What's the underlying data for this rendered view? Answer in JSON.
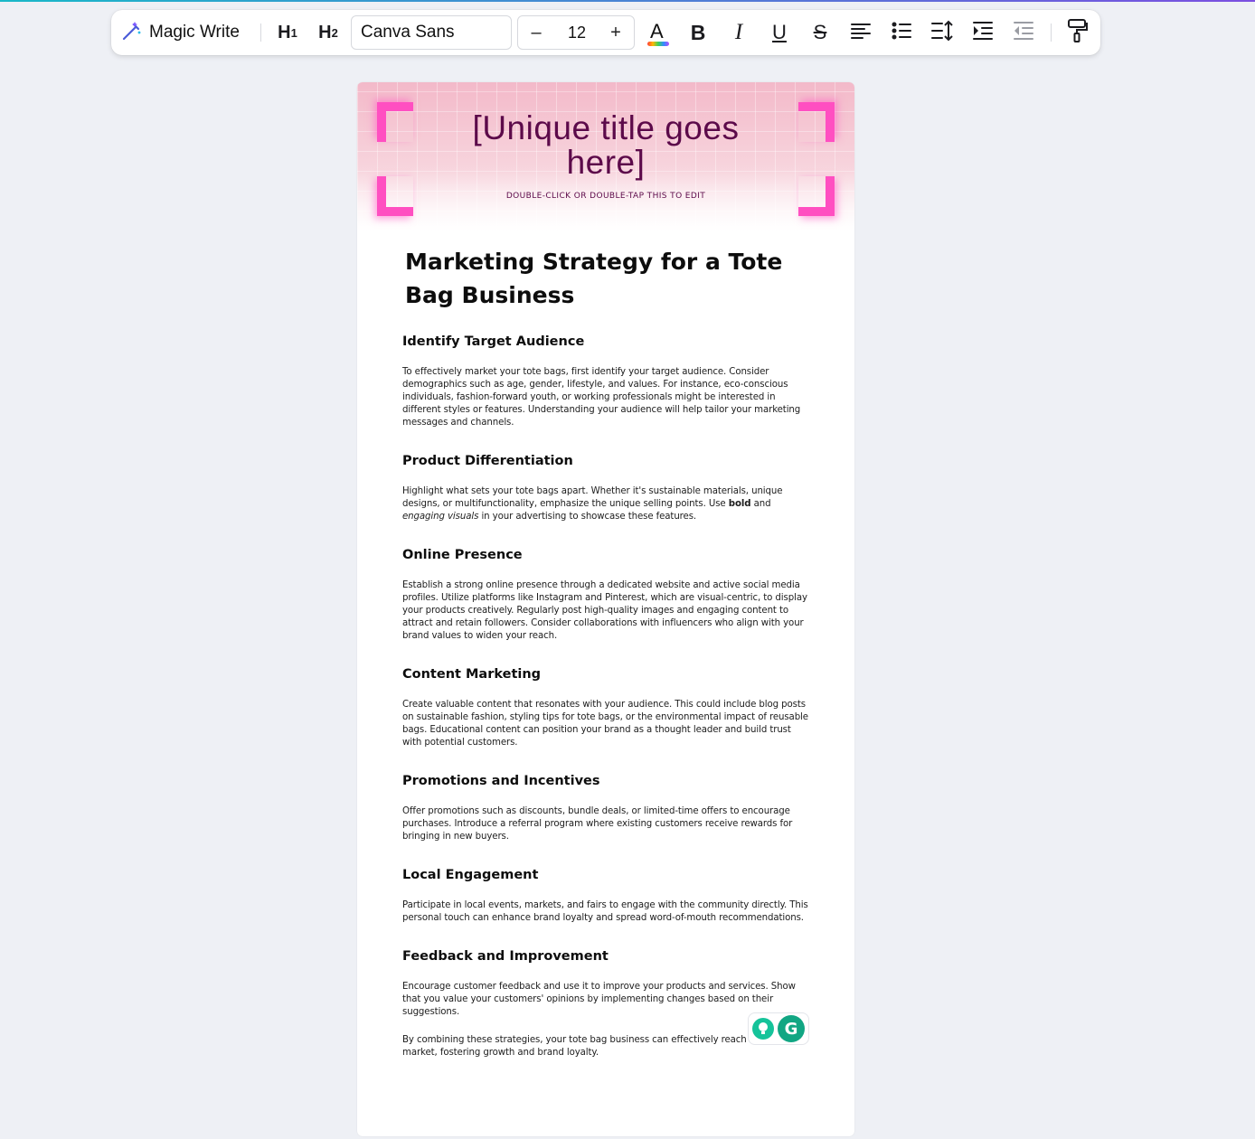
{
  "toolbar": {
    "magic_write_label": "Magic Write",
    "h1_label": "H",
    "h1_sub": "1",
    "h2_label": "H",
    "h2_sub": "2",
    "font_family": "Canva Sans",
    "font_size": "12",
    "minus": "–",
    "plus": "+",
    "text_color_letter": "A",
    "bold_letter": "B",
    "italic_letter": "I",
    "underline_letter": "U",
    "strike_letter": "S"
  },
  "banner": {
    "title": "[Unique title goes here]",
    "subtitle": "DOUBLE-CLICK OR DOUBLE-TAP THIS TO EDIT"
  },
  "doc": {
    "title": "Marketing Strategy for a Tote Bag Business",
    "sections": [
      {
        "heading": "Identify Target Audience",
        "body": "To effectively market your tote bags, first identify your target audience. Consider demographics such as age, gender, lifestyle, and values. For instance, eco-conscious individuals, fashion-forward youth, or working professionals might be interested in different styles or features. Understanding your audience will help tailor your marketing messages and channels."
      },
      {
        "heading": "Product Differentiation",
        "body_before_bold": "Highlight what sets your tote bags apart. Whether it's sustainable materials, unique designs, or multifunctionality, emphasize the unique selling points. Use ",
        "bold": "bold",
        "middle": " and ",
        "italic": "engaging visuals",
        "body_after": " in your advertising to showcase these features."
      },
      {
        "heading": "Online Presence",
        "body": "Establish a strong online presence through a dedicated website and active social media profiles. Utilize platforms like Instagram and Pinterest, which are visual-centric, to display your products creatively. Regularly post high-quality images and engaging content to attract and retain followers. Consider collaborations with influencers who align with your brand values to widen your reach."
      },
      {
        "heading": "Content Marketing",
        "body": "Create valuable content that resonates with your audience. This could include blog posts on sustainable fashion, styling tips for tote bags, or the environmental impact of reusable bags. Educational content can position your brand as a thought leader and build trust with potential customers."
      },
      {
        "heading": "Promotions and Incentives",
        "body": "Offer promotions such as discounts, bundle deals, or limited-time offers to encourage purchases. Introduce a referral program where existing customers receive rewards for bringing in new buyers."
      },
      {
        "heading": "Local Engagement",
        "body": "Participate in local events, markets, and fairs to engage with the community directly. This personal touch can enhance brand loyalty and spread word-of-mouth recommendations."
      },
      {
        "heading": "Feedback and Improvement",
        "body": "Encourage customer feedback and use it to improve your products and services. Show that you value your customers' opinions by implementing changes based on their suggestions."
      }
    ],
    "closing": "By combining these strategies, your tote bag business can effectively reach and target market, fostering growth and brand loyalty."
  },
  "grammarly": {
    "letter": "G"
  },
  "colors": {
    "banner_title": "#5c0a4a",
    "bracket": "#ff4fc1",
    "grammarly": "#11a683",
    "underline": "#f2c94c"
  },
  "icons": [
    "magic-wand-icon",
    "text-color-icon",
    "bold-icon",
    "italic-icon",
    "underline-icon",
    "strikethrough-icon",
    "align-left-icon",
    "bullet-list-icon",
    "line-spacing-icon",
    "indent-icon",
    "outdent-icon",
    "format-painter-icon",
    "grammarly-bulb-icon",
    "grammarly-logo-icon"
  ]
}
